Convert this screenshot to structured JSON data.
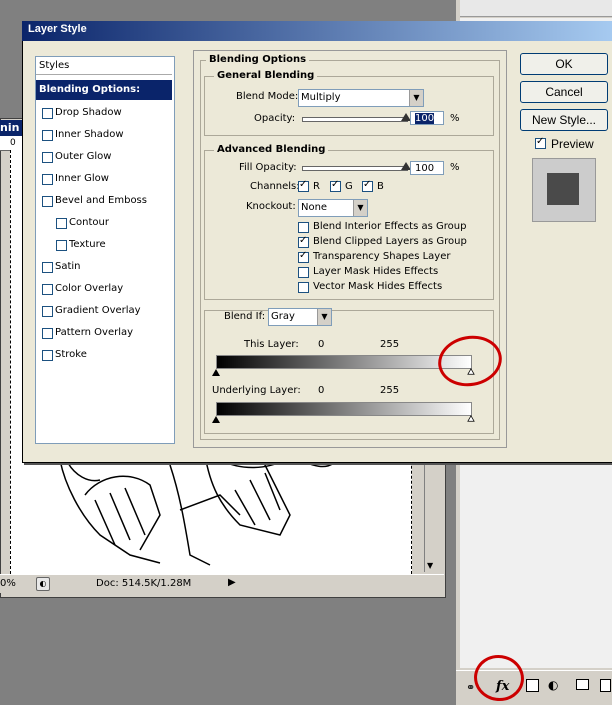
{
  "dialog": {
    "title": "Layer Style"
  },
  "document": {
    "title_fragment": "nin",
    "ruler_value": "0",
    "zoom": "0%",
    "doc_info": "Doc: 514.5K/1.28M"
  },
  "styles_panel": {
    "header": "Styles",
    "selected": "Blending Options: Custom",
    "items": [
      {
        "label": "Drop Shadow",
        "checked": false
      },
      {
        "label": "Inner Shadow",
        "checked": false
      },
      {
        "label": "Outer Glow",
        "checked": false
      },
      {
        "label": "Inner Glow",
        "checked": false
      },
      {
        "label": "Bevel and Emboss",
        "checked": false
      },
      {
        "label": "Contour",
        "checked": false
      },
      {
        "label": "Texture",
        "checked": false
      },
      {
        "label": "Satin",
        "checked": false
      },
      {
        "label": "Color Overlay",
        "checked": false
      },
      {
        "label": "Gradient Overlay",
        "checked": false
      },
      {
        "label": "Pattern Overlay",
        "checked": false
      },
      {
        "label": "Stroke",
        "checked": false
      }
    ]
  },
  "blending": {
    "section_title": "Blending Options",
    "general": {
      "title": "General Blending",
      "blend_mode_label": "Blend Mode:",
      "blend_mode_value": "Multiply",
      "opacity_label": "Opacity:",
      "opacity_value": "100",
      "opacity_unit": "%",
      "opacity_level": 1.0
    },
    "advanced": {
      "title": "Advanced Blending",
      "fill_opacity_label": "Fill Opacity:",
      "fill_opacity_value": "100",
      "fill_opacity_unit": "%",
      "fill_opacity_level": 1.0,
      "channels_label": "Channels:",
      "channels": [
        {
          "label": "R",
          "checked": true
        },
        {
          "label": "G",
          "checked": true
        },
        {
          "label": "B",
          "checked": true
        }
      ],
      "knockout_label": "Knockout:",
      "knockout_value": "None",
      "options": [
        {
          "label": "Blend Interior Effects as Group",
          "checked": false
        },
        {
          "label": "Blend Clipped Layers as Group",
          "checked": true
        },
        {
          "label": "Transparency Shapes Layer",
          "checked": true
        },
        {
          "label": "Layer Mask Hides Effects",
          "checked": false
        },
        {
          "label": "Vector Mask Hides Effects",
          "checked": false
        }
      ]
    },
    "blend_if": {
      "label": "Blend If:",
      "value": "Gray",
      "this_layer_label": "This Layer:",
      "this_layer_min": "0",
      "this_layer_max": "255",
      "underlying_label": "Underlying Layer:",
      "underlying_min": "0",
      "underlying_max": "255"
    }
  },
  "buttons": {
    "ok": "OK",
    "cancel": "Cancel",
    "new_style": "New Style...",
    "preview_label": "Preview",
    "preview_checked": true
  },
  "panel_bottom": {
    "fx_label": "fx"
  },
  "colors": {
    "title_bar": "#0a246a",
    "selection": "#0a246a",
    "annotation_red": "#cc0000",
    "dialog_bg": "#ece9d8"
  }
}
